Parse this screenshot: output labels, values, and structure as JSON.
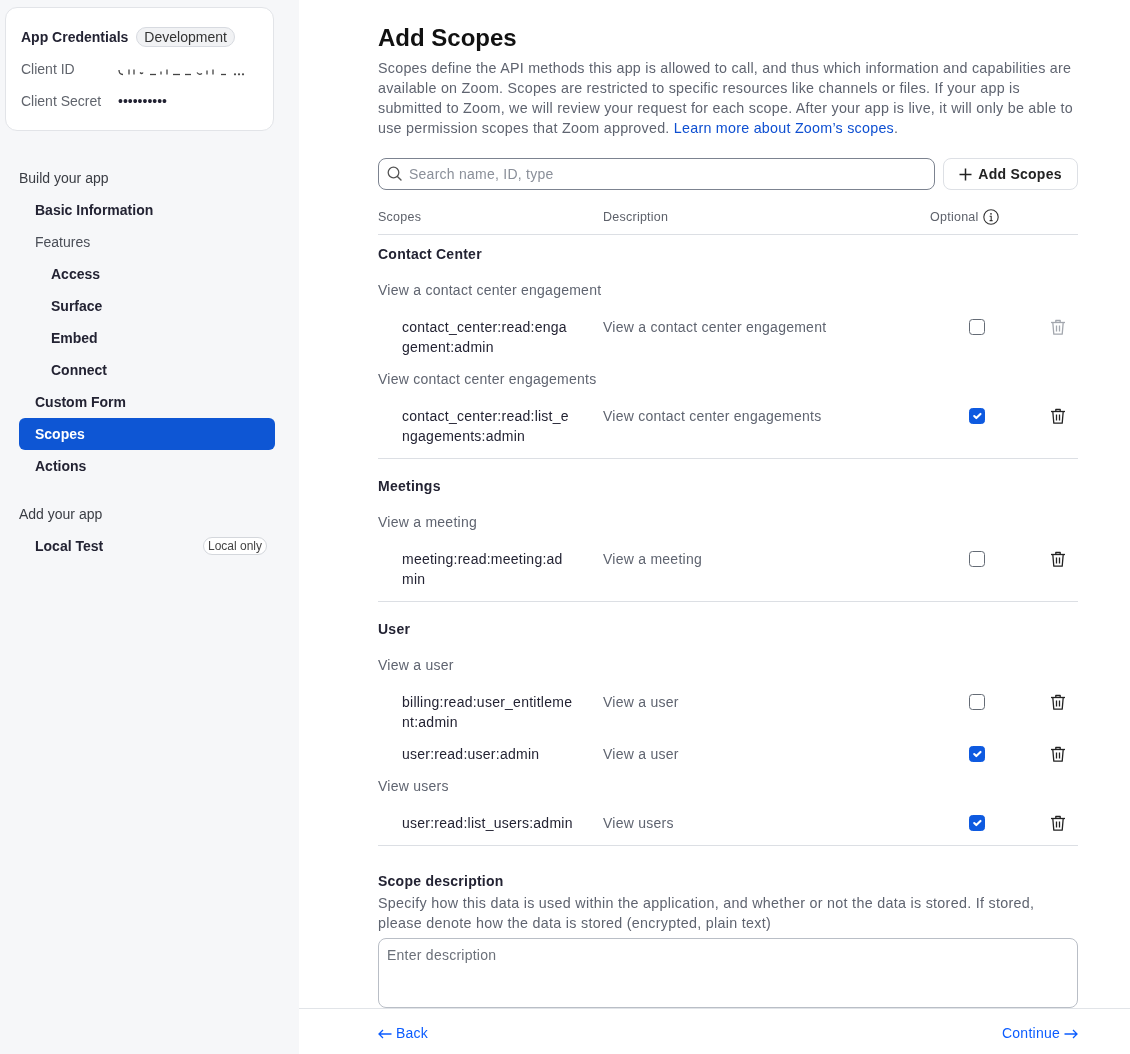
{
  "sidebar": {
    "credentials": {
      "title": "App Credentials",
      "badge": "Development",
      "fields": [
        {
          "label": "Client ID",
          "redacted": true
        },
        {
          "label": "Client Secret",
          "value": "••••••••••"
        }
      ]
    },
    "sections": [
      {
        "heading": "Build your app",
        "items": [
          {
            "label": "Basic Information",
            "selected": false
          },
          {
            "label": "Features",
            "selected": false,
            "children": [
              {
                "label": "Access",
                "selected": false
              },
              {
                "label": "Surface",
                "selected": false
              },
              {
                "label": "Embed",
                "selected": false
              },
              {
                "label": "Connect",
                "selected": false
              }
            ]
          },
          {
            "label": "Custom Form",
            "selected": false
          },
          {
            "label": "Scopes",
            "selected": true
          },
          {
            "label": "Actions",
            "selected": false
          }
        ]
      },
      {
        "heading": "Add your app",
        "items": [
          {
            "label": "Local Test",
            "selected": false,
            "badge": "Local only"
          }
        ]
      }
    ]
  },
  "main": {
    "title": "Add Scopes",
    "intro": "Scopes define the API methods this app is allowed to call, and thus which information and capabilities are available on Zoom. Scopes are restricted to specific resources like channels or files. If your app is submitted to Zoom, we will review your request for each scope. After your app is live, it will only be able to use permission scopes that Zoom approved. ",
    "intro_link": "Learn more about Zoom’s scopes",
    "intro_end": ".",
    "search": {
      "placeholder": "Search name, ID, type"
    },
    "add_button": "Add Scopes",
    "table": {
      "columns": [
        {
          "label": "Scopes"
        },
        {
          "label": "Description"
        },
        {
          "label": "Optional",
          "info": true
        }
      ],
      "groups": [
        {
          "name": "Contact Center",
          "subgroups": [
            {
              "name": "View a contact center engagement",
              "scopes": [
                {
                  "scope": "contact_center:read:engagement:admin",
                  "description": "View a contact center engagement",
                  "checked": false,
                  "delete_disabled": true
                }
              ]
            },
            {
              "name": "View contact center engagements",
              "scopes": [
                {
                  "scope": "contact_center:read:list_engagements:admin",
                  "description": "View contact center engagements",
                  "checked": true,
                  "delete_disabled": false
                }
              ]
            }
          ]
        },
        {
          "name": "Meetings",
          "subgroups": [
            {
              "name": "View a meeting",
              "scopes": [
                {
                  "scope": "meeting:read:meeting:admin",
                  "description": "View a meeting",
                  "checked": false,
                  "delete_disabled": false
                }
              ]
            }
          ]
        },
        {
          "name": "User",
          "subgroups": [
            {
              "name": "View a user",
              "scopes": [
                {
                  "scope": "billing:read:user_entitlement:admin",
                  "description": "View a user",
                  "checked": false,
                  "delete_disabled": false
                },
                {
                  "scope": "user:read:user:admin",
                  "description": "View a user",
                  "checked": true,
                  "delete_disabled": false
                }
              ]
            },
            {
              "name": "View users",
              "scopes": [
                {
                  "scope": "user:read:list_users:admin",
                  "description": "View users",
                  "checked": true,
                  "delete_disabled": false
                }
              ]
            }
          ]
        }
      ]
    },
    "scope_description": {
      "label": "Scope description",
      "help": "Specify how this data is used within the application, and whether or not the data is stored. If stored, please denote how the data is stored (encrypted, plain text)",
      "placeholder": "Enter description"
    }
  },
  "footer": {
    "back": "Back",
    "continue": "Continue"
  }
}
